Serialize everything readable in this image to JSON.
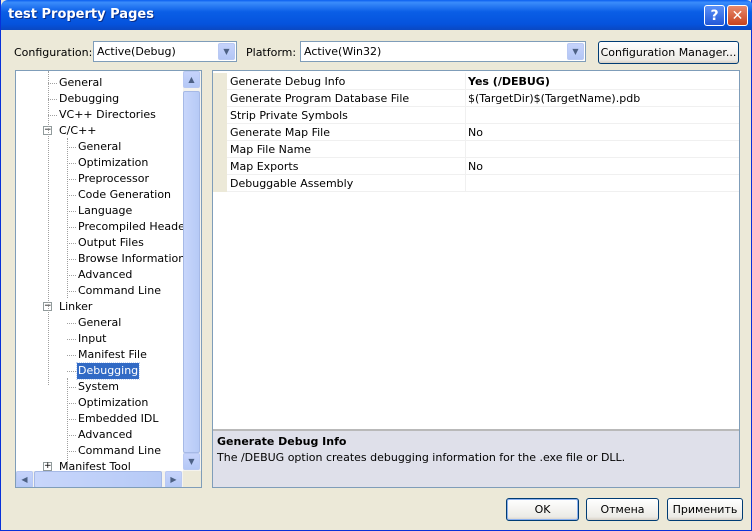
{
  "window": {
    "title": "test Property Pages"
  },
  "titlebar": {
    "help_glyph": "?",
    "close_glyph": "✕"
  },
  "config": {
    "label": "Configuration:",
    "value": "Active(Debug)"
  },
  "platform": {
    "label": "Platform:",
    "value": "Active(Win32)"
  },
  "config_manager_label": "Configuration Manager...",
  "tree": {
    "items": [
      {
        "label": "General",
        "level": 1,
        "expander": ""
      },
      {
        "label": "Debugging",
        "level": 1,
        "expander": ""
      },
      {
        "label": "VC++ Directories",
        "level": 1,
        "expander": ""
      },
      {
        "label": "C/C++",
        "level": 1,
        "expander": "−"
      },
      {
        "label": "General",
        "level": 2,
        "expander": ""
      },
      {
        "label": "Optimization",
        "level": 2,
        "expander": ""
      },
      {
        "label": "Preprocessor",
        "level": 2,
        "expander": ""
      },
      {
        "label": "Code Generation",
        "level": 2,
        "expander": ""
      },
      {
        "label": "Language",
        "level": 2,
        "expander": ""
      },
      {
        "label": "Precompiled Headers",
        "level": 2,
        "expander": ""
      },
      {
        "label": "Output Files",
        "level": 2,
        "expander": ""
      },
      {
        "label": "Browse Information",
        "level": 2,
        "expander": ""
      },
      {
        "label": "Advanced",
        "level": 2,
        "expander": ""
      },
      {
        "label": "Command Line",
        "level": 2,
        "expander": ""
      },
      {
        "label": "Linker",
        "level": 1,
        "expander": "−"
      },
      {
        "label": "General",
        "level": 2,
        "expander": ""
      },
      {
        "label": "Input",
        "level": 2,
        "expander": ""
      },
      {
        "label": "Manifest File",
        "level": 2,
        "expander": ""
      },
      {
        "label": "Debugging",
        "level": 2,
        "expander": "",
        "selected": true
      },
      {
        "label": "System",
        "level": 2,
        "expander": ""
      },
      {
        "label": "Optimization",
        "level": 2,
        "expander": ""
      },
      {
        "label": "Embedded IDL",
        "level": 2,
        "expander": ""
      },
      {
        "label": "Advanced",
        "level": 2,
        "expander": ""
      },
      {
        "label": "Command Line",
        "level": 2,
        "expander": ""
      },
      {
        "label": "Manifest Tool",
        "level": 1,
        "expander": "+"
      }
    ]
  },
  "scroll_glyphs": {
    "up": "▲",
    "down": "▼",
    "left": "◀",
    "right": "▶"
  },
  "properties": [
    {
      "name": "Generate Debug Info",
      "value": "Yes (/DEBUG)",
      "bold": true
    },
    {
      "name": "Generate Program Database File",
      "value": "$(TargetDir)$(TargetName).pdb",
      "bold": false
    },
    {
      "name": "Strip Private Symbols",
      "value": "",
      "bold": false
    },
    {
      "name": "Generate Map File",
      "value": "No",
      "bold": false
    },
    {
      "name": "Map File Name",
      "value": "",
      "bold": false
    },
    {
      "name": "Map Exports",
      "value": "No",
      "bold": false
    },
    {
      "name": "Debuggable Assembly",
      "value": "",
      "bold": false
    }
  ],
  "description": {
    "title": "Generate Debug Info",
    "text": "The /DEBUG option creates debugging information for the .exe file or DLL."
  },
  "buttons": {
    "ok": "OK",
    "cancel": "Отмена",
    "apply": "Применить"
  },
  "colors": {
    "selection": "#316ac5",
    "titlebar": "#0553dd",
    "dialog_bg": "#ece9d8"
  }
}
